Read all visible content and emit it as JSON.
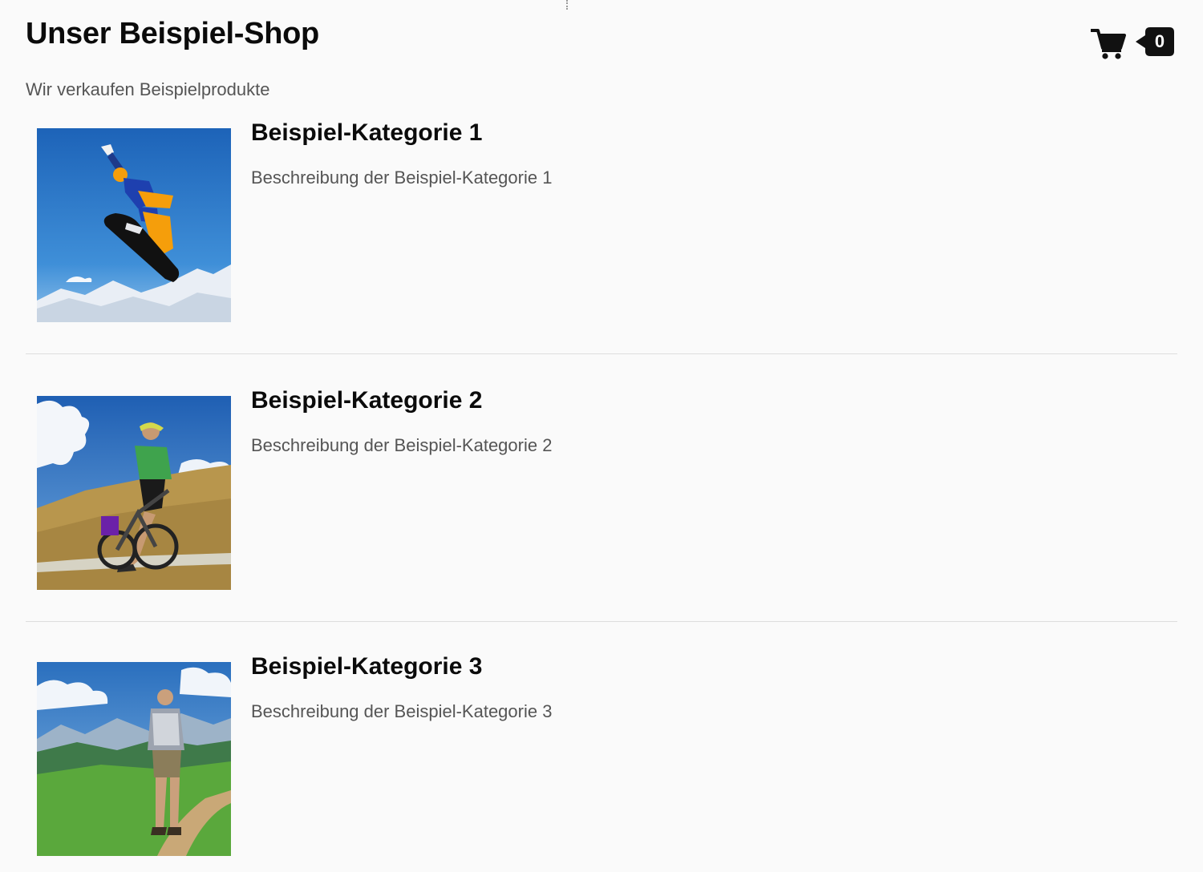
{
  "header": {
    "title": "Unser Beispiel-Shop",
    "subtitle": "Wir verkaufen Beispielprodukte"
  },
  "cart": {
    "count": "0",
    "icon": "shopping-cart-icon"
  },
  "categories": [
    {
      "title": "Beispiel-Kategorie 1",
      "description": "Beschreibung der Beispiel-Kategorie 1",
      "image": "snowboarder-photo"
    },
    {
      "title": "Beispiel-Kategorie 2",
      "description": "Beschreibung der Beispiel-Kategorie 2",
      "image": "mountain-biker-photo"
    },
    {
      "title": "Beispiel-Kategorie 3",
      "description": "Beschreibung der Beispiel-Kategorie 3",
      "image": "hiker-photo"
    }
  ],
  "colors": {
    "background": "#fafafa",
    "text": "#0b0b0b",
    "muted_text": "#555555",
    "divider": "#dedede",
    "badge": "#111111"
  }
}
